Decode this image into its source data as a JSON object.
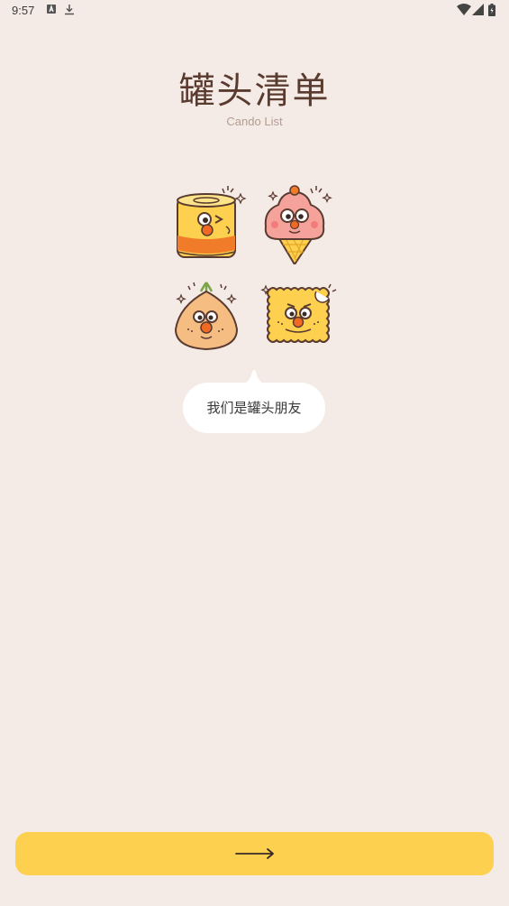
{
  "status_bar": {
    "time": "9:57",
    "icons": [
      "notification-a-icon",
      "download-icon",
      "wifi-icon",
      "signal-icon",
      "battery-icon"
    ]
  },
  "header": {
    "title": "罐头清单",
    "subtitle": "Cando List"
  },
  "mascots": [
    "can-mascot-icon",
    "ice-cream-mascot-icon",
    "onion-mascot-icon",
    "cracker-mascot-icon"
  ],
  "bubble": {
    "text": "我们是罐头朋友"
  },
  "next_button": {
    "icon": "arrow-right-icon"
  },
  "colors": {
    "background": "#f5ebe6",
    "button": "#fdd14f",
    "title": "#5a3b30",
    "subtitle": "#b39c92"
  }
}
